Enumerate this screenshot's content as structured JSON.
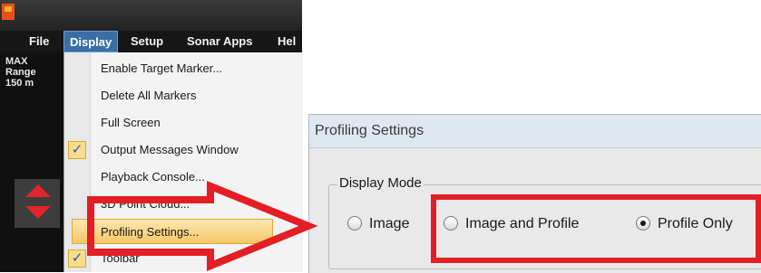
{
  "menubar": {
    "items": [
      "File",
      "Display",
      "Setup",
      "Sonar Apps",
      "Hel"
    ]
  },
  "side_panel": {
    "max_range_line1": "MAX",
    "max_range_line2": "Range",
    "range_value": "150 m"
  },
  "display_menu": {
    "items": [
      {
        "label": "Enable Target Marker...",
        "checked": false
      },
      {
        "label": "Delete All Markers",
        "checked": false
      },
      {
        "label": "Full Screen",
        "checked": false
      },
      {
        "label": "Output Messages Window",
        "checked": true
      },
      {
        "label": "Playback Console...",
        "checked": false
      },
      {
        "label": "3D Point Cloud...",
        "checked": false
      },
      {
        "label": "Profiling Settings...",
        "checked": false,
        "highlighted": true
      },
      {
        "label": "Toolbar",
        "checked": true
      }
    ],
    "check_glyph": "✓"
  },
  "dialog": {
    "title": "Profiling Settings",
    "group_label": "Display Mode",
    "options": [
      {
        "label": "Image",
        "selected": false
      },
      {
        "label": "Image and Profile",
        "selected": false
      },
      {
        "label": "Profile Only",
        "selected": true
      }
    ]
  },
  "colors": {
    "annotation_red": "#e31e24",
    "menu_highlight": "#f6c766",
    "accent_blue": "#3a6ea5"
  }
}
